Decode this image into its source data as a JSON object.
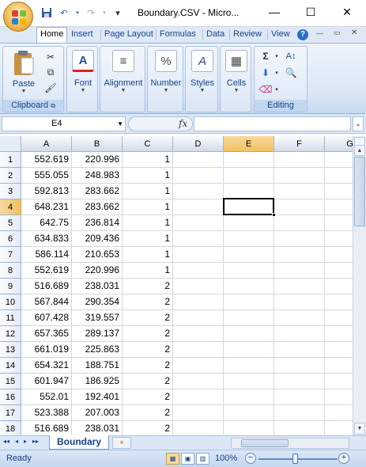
{
  "window": {
    "title": "Boundary.CSV - Micro...",
    "minimize": "—",
    "maximize": "☐",
    "close": "✕"
  },
  "qat": {
    "save_icon": "floppy-disk-icon",
    "undo": "↶",
    "redo": "↷",
    "customize": "▾"
  },
  "ribbon": {
    "tabs": [
      "Home",
      "Insert",
      "Page Layout",
      "Formulas",
      "Data",
      "Review",
      "View"
    ],
    "help": "?",
    "groups": {
      "clipboard": {
        "label": "Clipboard",
        "paste": "Paste"
      },
      "font": {
        "label": "Font"
      },
      "alignment": {
        "label": "Alignment"
      },
      "number": {
        "label": "Number",
        "icon_text": "%"
      },
      "styles": {
        "label": "Styles"
      },
      "cells": {
        "label": "Cells"
      },
      "editing": {
        "label": "Editing",
        "sum": "Σ"
      }
    }
  },
  "formula_bar": {
    "name_box": "E4",
    "fx": "fx",
    "formula": ""
  },
  "grid": {
    "columns": [
      "A",
      "B",
      "C",
      "D",
      "E",
      "F",
      "G"
    ],
    "selected_column": "E",
    "selected_row": "4",
    "rows": [
      {
        "n": "1",
        "a": "552.619",
        "b": "220.996",
        "c": "1"
      },
      {
        "n": "2",
        "a": "555.055",
        "b": "248.983",
        "c": "1"
      },
      {
        "n": "3",
        "a": "592.813",
        "b": "283.662",
        "c": "1"
      },
      {
        "n": "4",
        "a": "648.231",
        "b": "283.662",
        "c": "1"
      },
      {
        "n": "5",
        "a": "642.75",
        "b": "236.814",
        "c": "1"
      },
      {
        "n": "6",
        "a": "634.833",
        "b": "209.436",
        "c": "1"
      },
      {
        "n": "7",
        "a": "586.114",
        "b": "210.653",
        "c": "1"
      },
      {
        "n": "8",
        "a": "552.619",
        "b": "220.996",
        "c": "1"
      },
      {
        "n": "9",
        "a": "516.689",
        "b": "238.031",
        "c": "2"
      },
      {
        "n": "10",
        "a": "567.844",
        "b": "290.354",
        "c": "2"
      },
      {
        "n": "11",
        "a": "607.428",
        "b": "319.557",
        "c": "2"
      },
      {
        "n": "12",
        "a": "657.365",
        "b": "289.137",
        "c": "2"
      },
      {
        "n": "13",
        "a": "661.019",
        "b": "225.863",
        "c": "2"
      },
      {
        "n": "14",
        "a": "654.321",
        "b": "188.751",
        "c": "2"
      },
      {
        "n": "15",
        "a": "601.947",
        "b": "186.925",
        "c": "2"
      },
      {
        "n": "16",
        "a": "552.01",
        "b": "192.401",
        "c": "2"
      },
      {
        "n": "17",
        "a": "523.388",
        "b": "207.003",
        "c": "2"
      },
      {
        "n": "18",
        "a": "516.689",
        "b": "238.031",
        "c": "2"
      }
    ]
  },
  "sheets": {
    "nav": "◂◂ ◂ ▸ ▸▸",
    "active_tab": "Boundary",
    "new_sheet_icon": "new-sheet-icon"
  },
  "status": {
    "text": "Ready",
    "zoom": "100%",
    "zoom_out": "−",
    "zoom_in": "+"
  },
  "colors": {
    "accent": "#15428b",
    "selection": "#f9d99f",
    "ribbon": "#dbe7f6"
  }
}
